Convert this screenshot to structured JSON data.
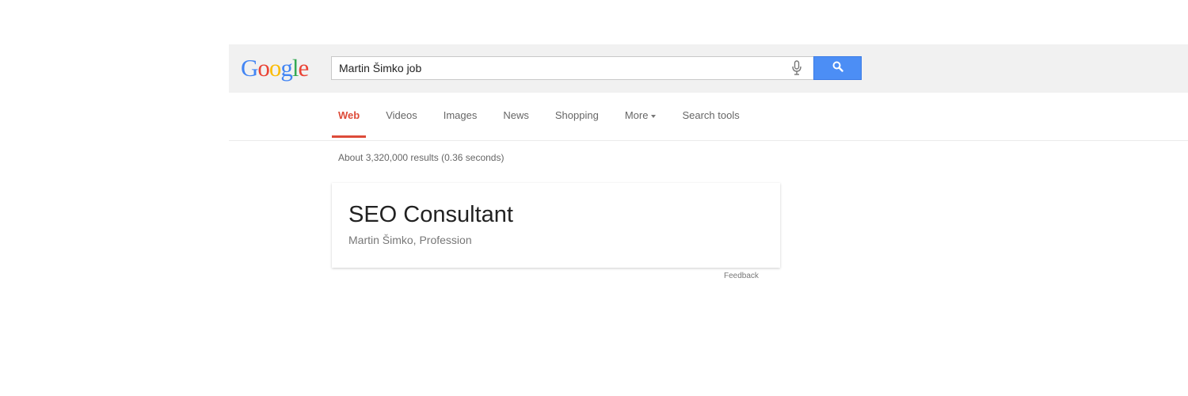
{
  "logo": {
    "letters": [
      "G",
      "o",
      "o",
      "g",
      "l",
      "e"
    ],
    "colors": [
      "#4285f4",
      "#ea4335",
      "#fbbc05",
      "#4285f4",
      "#34a853",
      "#ea4335"
    ]
  },
  "search": {
    "query": "Martin Šimko job"
  },
  "tabs": [
    {
      "label": "Web",
      "active": true
    },
    {
      "label": "Videos"
    },
    {
      "label": "Images"
    },
    {
      "label": "News"
    },
    {
      "label": "Shopping"
    },
    {
      "label": "More"
    },
    {
      "label": "Search tools"
    }
  ],
  "results": {
    "stats": "About 3,320,000 results (0.36 seconds)"
  },
  "answer_card": {
    "title": "SEO Consultant",
    "subtitle": "Martin Šimko, Profession"
  },
  "feedback_label": "Feedback",
  "colors": {
    "accent_red": "#dd4b39",
    "search_button_blue": "#4c8ef5",
    "header_bg": "#f1f1f1"
  }
}
